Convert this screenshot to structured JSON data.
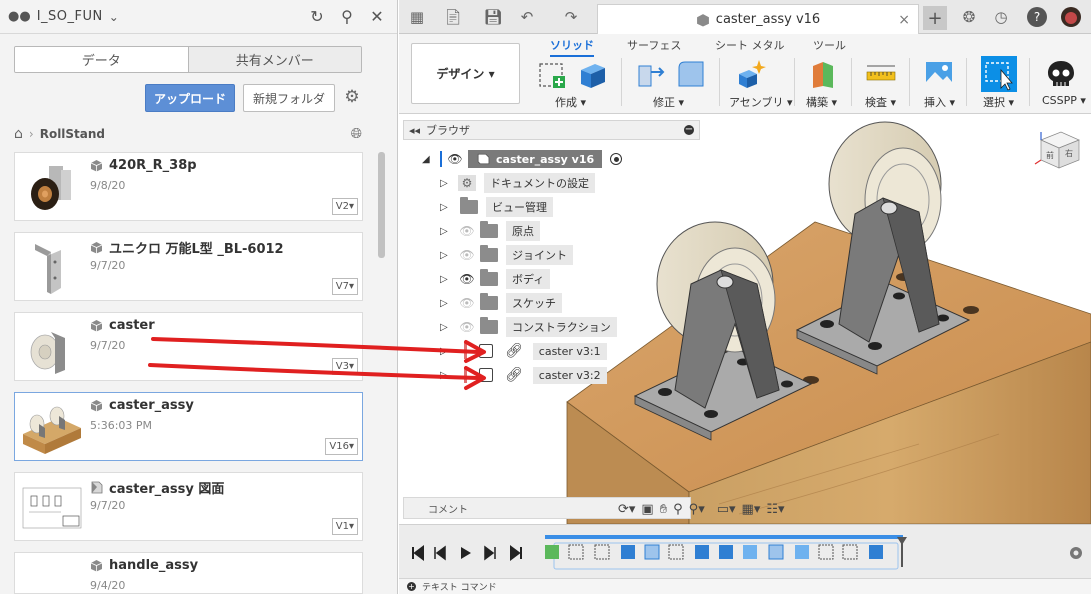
{
  "left_panel": {
    "team_name": "I_SO_FUN",
    "tabs": [
      "データ",
      "共有メンバー"
    ],
    "upload_label": "アップロード",
    "new_folder_label": "新規フォルダ",
    "breadcrumb": "RollStand",
    "items": [
      {
        "name": "420R_R_38p",
        "date": "9/8/20",
        "version": "V2▾"
      },
      {
        "name": "ユニクロ 万能L型 _BL-6012",
        "date": "9/7/20",
        "version": "V7▾"
      },
      {
        "name": "caster",
        "date": "9/7/20",
        "version": "V3▾"
      },
      {
        "name": "caster_assy",
        "date": "5:36:03 PM",
        "version": "V16▾"
      },
      {
        "name": "caster_assy 図面",
        "date": "9/7/20",
        "version": "V1▾"
      },
      {
        "name": "handle_assy",
        "date": "9/4/20",
        "version": ""
      }
    ]
  },
  "document_tab": {
    "title": "caster_assy v16",
    "close": "×"
  },
  "ribbon": {
    "workspace": "デザイン ▾",
    "tabs": [
      "ソリッド",
      "サーフェス",
      "シート メタル",
      "ツール"
    ],
    "groups": [
      "作成 ▾",
      "修正 ▾",
      "アセンブリ ▾",
      "構築 ▾",
      "検査 ▾",
      "挿入 ▾",
      "選択 ▾",
      "CSSPP ▾"
    ]
  },
  "browser": {
    "title": "ブラウザ",
    "root": "caster_assy v16",
    "nodes": [
      "ドキュメントの設定",
      "ビュー管理",
      "原点",
      "ジョイント",
      "ボディ",
      "スケッチ",
      "コンストラクション",
      "caster v3:1",
      "caster v3:2"
    ]
  },
  "comment_label": "コメント",
  "bottom_label": "テキスト コマンド",
  "viewcube": {
    "front": "前",
    "right": "右"
  },
  "colors": {
    "accent": "#1a6fd8",
    "upload": "#5d8fd6",
    "arrow": "#e02020"
  }
}
